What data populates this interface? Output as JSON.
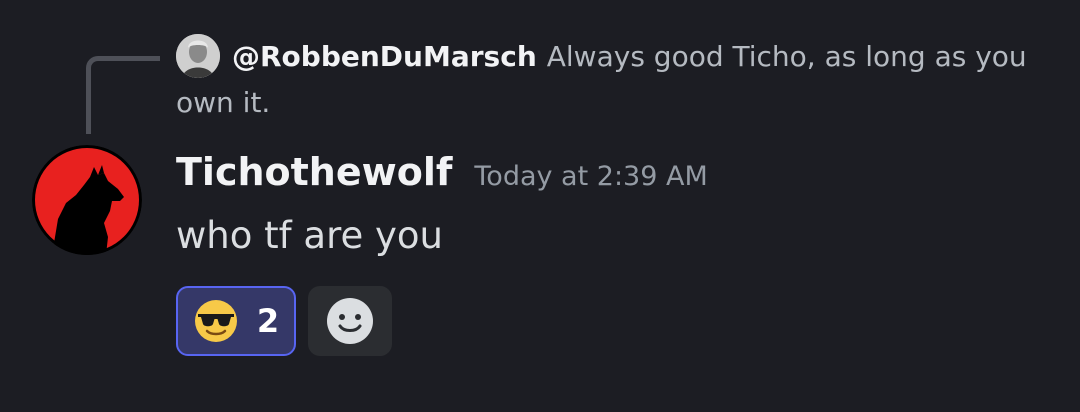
{
  "reply": {
    "author": "@RobbenDuMarsch",
    "text": "Always good Ticho, as long as you own it."
  },
  "message": {
    "username": "Tichothewolf",
    "timestamp": "Today at 2:39 AM",
    "content": "who tf are you"
  },
  "reactions": [
    {
      "emoji": "smiling-face-with-sunglasses",
      "count": "2",
      "active": true
    }
  ],
  "add_reaction_icon": "add-reaction-smiley",
  "colors": {
    "background": "#1c1d23",
    "username": "#f2f3f5",
    "timestamp": "#949ba4",
    "reaction_border": "#5865f2",
    "reaction_bg": "#353868",
    "avatar_red": "#e8211f"
  }
}
